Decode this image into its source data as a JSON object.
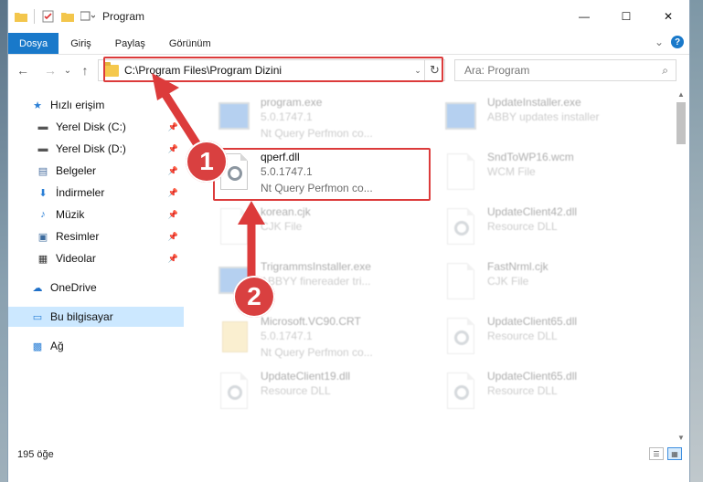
{
  "window": {
    "title": "Program",
    "controls": {
      "minimize": "—",
      "maximize": "☐",
      "close": "✕"
    }
  },
  "ribbon": {
    "tabs": [
      {
        "label": "Dosya",
        "active": true
      },
      {
        "label": "Giriş"
      },
      {
        "label": "Paylaş"
      },
      {
        "label": "Görünüm"
      }
    ],
    "collapse": "⌄",
    "help": "?"
  },
  "nav": {
    "back": "←",
    "forward": "→",
    "history": "⌄",
    "up": "↑"
  },
  "address": {
    "path": "C:\\Program Files\\Program Dizini",
    "dropdown": "⌄",
    "refresh": "↻"
  },
  "search": {
    "placeholder": "Ara: Program",
    "icon": "⌕"
  },
  "sidebar": {
    "items": [
      {
        "label": "Hızlı erişim",
        "icon": "star-icon",
        "glyph": "★",
        "color": "#2a7fd6",
        "pinned": false
      },
      {
        "label": "Yerel Disk (C:)",
        "icon": "drive-icon",
        "glyph": "▬",
        "color": "#555555",
        "pinned": true
      },
      {
        "label": "Yerel Disk (D:)",
        "icon": "drive-icon",
        "glyph": "▬",
        "color": "#555555",
        "pinned": true
      },
      {
        "label": "Belgeler",
        "icon": "documents-icon",
        "glyph": "▤",
        "color": "#4a6fa0",
        "pinned": true
      },
      {
        "label": "İndirmeler",
        "icon": "download-icon",
        "glyph": "⬇",
        "color": "#2a7fd6",
        "pinned": true
      },
      {
        "label": "Müzik",
        "icon": "music-icon",
        "glyph": "♪",
        "color": "#2a7fd6",
        "pinned": true
      },
      {
        "label": "Resimler",
        "icon": "pictures-icon",
        "glyph": "▣",
        "color": "#3d6c9e",
        "pinned": true
      },
      {
        "label": "Videolar",
        "icon": "videos-icon",
        "glyph": "▦",
        "color": "#333333",
        "pinned": true
      },
      {
        "label": "OneDrive",
        "icon": "cloud-icon",
        "glyph": "☁",
        "color": "#1f70c8",
        "pinned": false
      },
      {
        "label": "Bu bilgisayar",
        "icon": "computer-icon",
        "glyph": "▭",
        "color": "#2a7fd6",
        "pinned": false,
        "selected": true
      },
      {
        "label": "Ağ",
        "icon": "network-icon",
        "glyph": "▩",
        "color": "#2a7fd6",
        "pinned": false
      }
    ],
    "pin_glyph": "📌"
  },
  "files": {
    "left": [
      {
        "name": "program.exe",
        "line1": "5.0.1747.1",
        "line2": "Nt Query Perfmon co...",
        "kind": "exe",
        "faded": true
      },
      {
        "name": "qperf.dll",
        "line1": "5.0.1747.1",
        "line2": "Nt Query Perfmon co...",
        "kind": "dll",
        "faded": false
      },
      {
        "name": "korean.cjk",
        "line1": "CJK File",
        "line2": "",
        "kind": "doc",
        "faded": true
      },
      {
        "name": "TrigrammsInstaller.exe",
        "line1": "ABBYY finereader tri...",
        "line2": "",
        "kind": "app",
        "faded": true
      },
      {
        "name": "Microsoft.VC90.CRT",
        "line1": "5.0.1747.1",
        "line2": "Nt Query Perfmon co...",
        "kind": "folder",
        "faded": true
      },
      {
        "name": "UpdateClient19.dll",
        "line1": "Resource DLL",
        "line2": "",
        "kind": "dll",
        "faded": true
      }
    ],
    "right": [
      {
        "name": "UpdateInstaller.exe",
        "line1": "ABBY updates installer",
        "line2": "",
        "kind": "app",
        "faded": true
      },
      {
        "name": "SndToWP16.wcm",
        "line1": "WCM File",
        "line2": "",
        "kind": "doc",
        "faded": true
      },
      {
        "name": "UpdateClient42.dll",
        "line1": "Resource DLL",
        "line2": "",
        "kind": "dll",
        "faded": true
      },
      {
        "name": "FastNrml.cjk",
        "line1": "CJK File",
        "line2": "",
        "kind": "doc",
        "faded": true
      },
      {
        "name": "UpdateClient65.dll",
        "line1": "Resource DLL",
        "line2": "",
        "kind": "dll",
        "faded": true
      },
      {
        "name": "UpdateClient65.dll",
        "line1": "Resource DLL",
        "line2": "",
        "kind": "dll",
        "faded": true
      }
    ]
  },
  "status": {
    "count": "195 öğe"
  },
  "annotations": {
    "step1": "1",
    "step2": "2",
    "color": "#dc3b3b"
  },
  "scroll": {
    "up": "▲",
    "down": "▼"
  },
  "views": {
    "details": "☰",
    "large_icons": "▦"
  }
}
